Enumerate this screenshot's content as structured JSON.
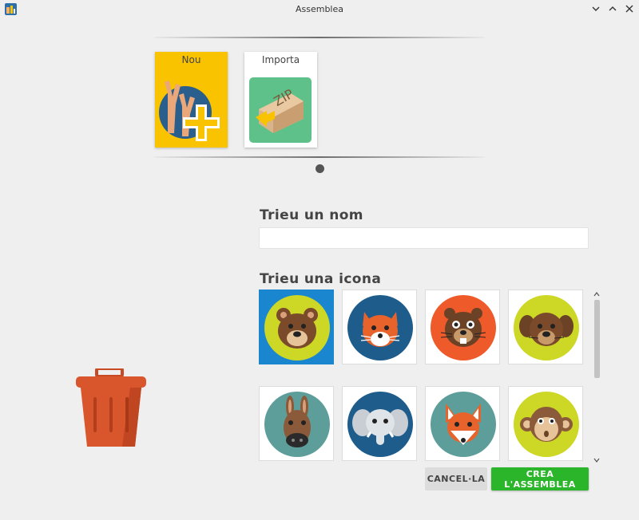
{
  "window": {
    "title": "Assemblea"
  },
  "cards": [
    {
      "label": "Nou"
    },
    {
      "label": "Importa",
      "zip_text": "ZIP"
    }
  ],
  "form": {
    "name_label": "Trieu un nom",
    "name_value": "",
    "name_placeholder": "",
    "icon_label": "Trieu una icona"
  },
  "icons": [
    {
      "animal": "bear",
      "selected": true
    },
    {
      "animal": "fox",
      "selected": false
    },
    {
      "animal": "beaver",
      "selected": false
    },
    {
      "animal": "dog",
      "selected": false
    },
    {
      "animal": "donkey",
      "selected": false
    },
    {
      "animal": "elephant",
      "selected": false
    },
    {
      "animal": "fox-teal",
      "selected": false
    },
    {
      "animal": "monkey",
      "selected": false
    }
  ],
  "buttons": {
    "cancel": "CANCEL·LA",
    "create": "CREA L'ASSEMBLEA"
  },
  "colors": {
    "nou_card": "#f9c300",
    "create_button": "#2bb52b",
    "selected_tile": "#1a86d0",
    "trash": "#d9552c"
  }
}
